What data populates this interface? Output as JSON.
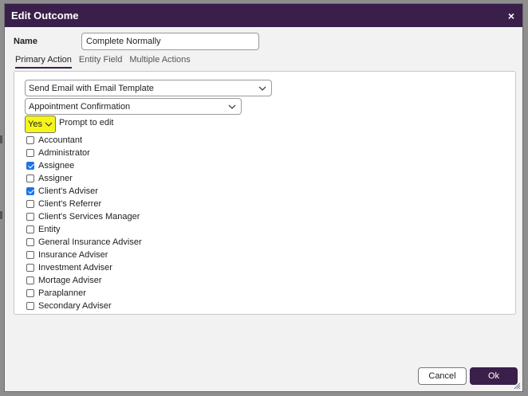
{
  "dialog": {
    "title": "Edit Outcome",
    "close_symbol": "×",
    "name_label": "Name",
    "name_value": "Complete Normally"
  },
  "tabs": [
    {
      "label": "Primary Action",
      "active": true
    },
    {
      "label": "Entity Field",
      "active": false
    },
    {
      "label": "Multiple Actions",
      "active": false
    }
  ],
  "action": {
    "action_select": "Send Email with Email Template",
    "template_select": "Appointment Confirmation",
    "prompt_value": "Yes",
    "prompt_label": "Prompt to edit"
  },
  "recipients": [
    {
      "label": "Accountant",
      "checked": false
    },
    {
      "label": "Administrator",
      "checked": false
    },
    {
      "label": "Assignee",
      "checked": true
    },
    {
      "label": "Assigner",
      "checked": false
    },
    {
      "label": "Client's Adviser",
      "checked": true
    },
    {
      "label": "Client's Referrer",
      "checked": false
    },
    {
      "label": "Client's Services Manager",
      "checked": false
    },
    {
      "label": "Entity",
      "checked": false
    },
    {
      "label": "General Insurance Adviser",
      "checked": false
    },
    {
      "label": "Insurance Adviser",
      "checked": false
    },
    {
      "label": "Investment Adviser",
      "checked": false
    },
    {
      "label": "Mortage Adviser",
      "checked": false
    },
    {
      "label": "Paraplanner",
      "checked": false
    },
    {
      "label": "Secondary Adviser",
      "checked": false
    }
  ],
  "buttons": {
    "cancel": "Cancel",
    "ok": "Ok"
  },
  "colors": {
    "title_bar": "#3b1f4b",
    "checkbox_checked": "#1a73e8",
    "prompt_highlight": "#f5f51a"
  }
}
